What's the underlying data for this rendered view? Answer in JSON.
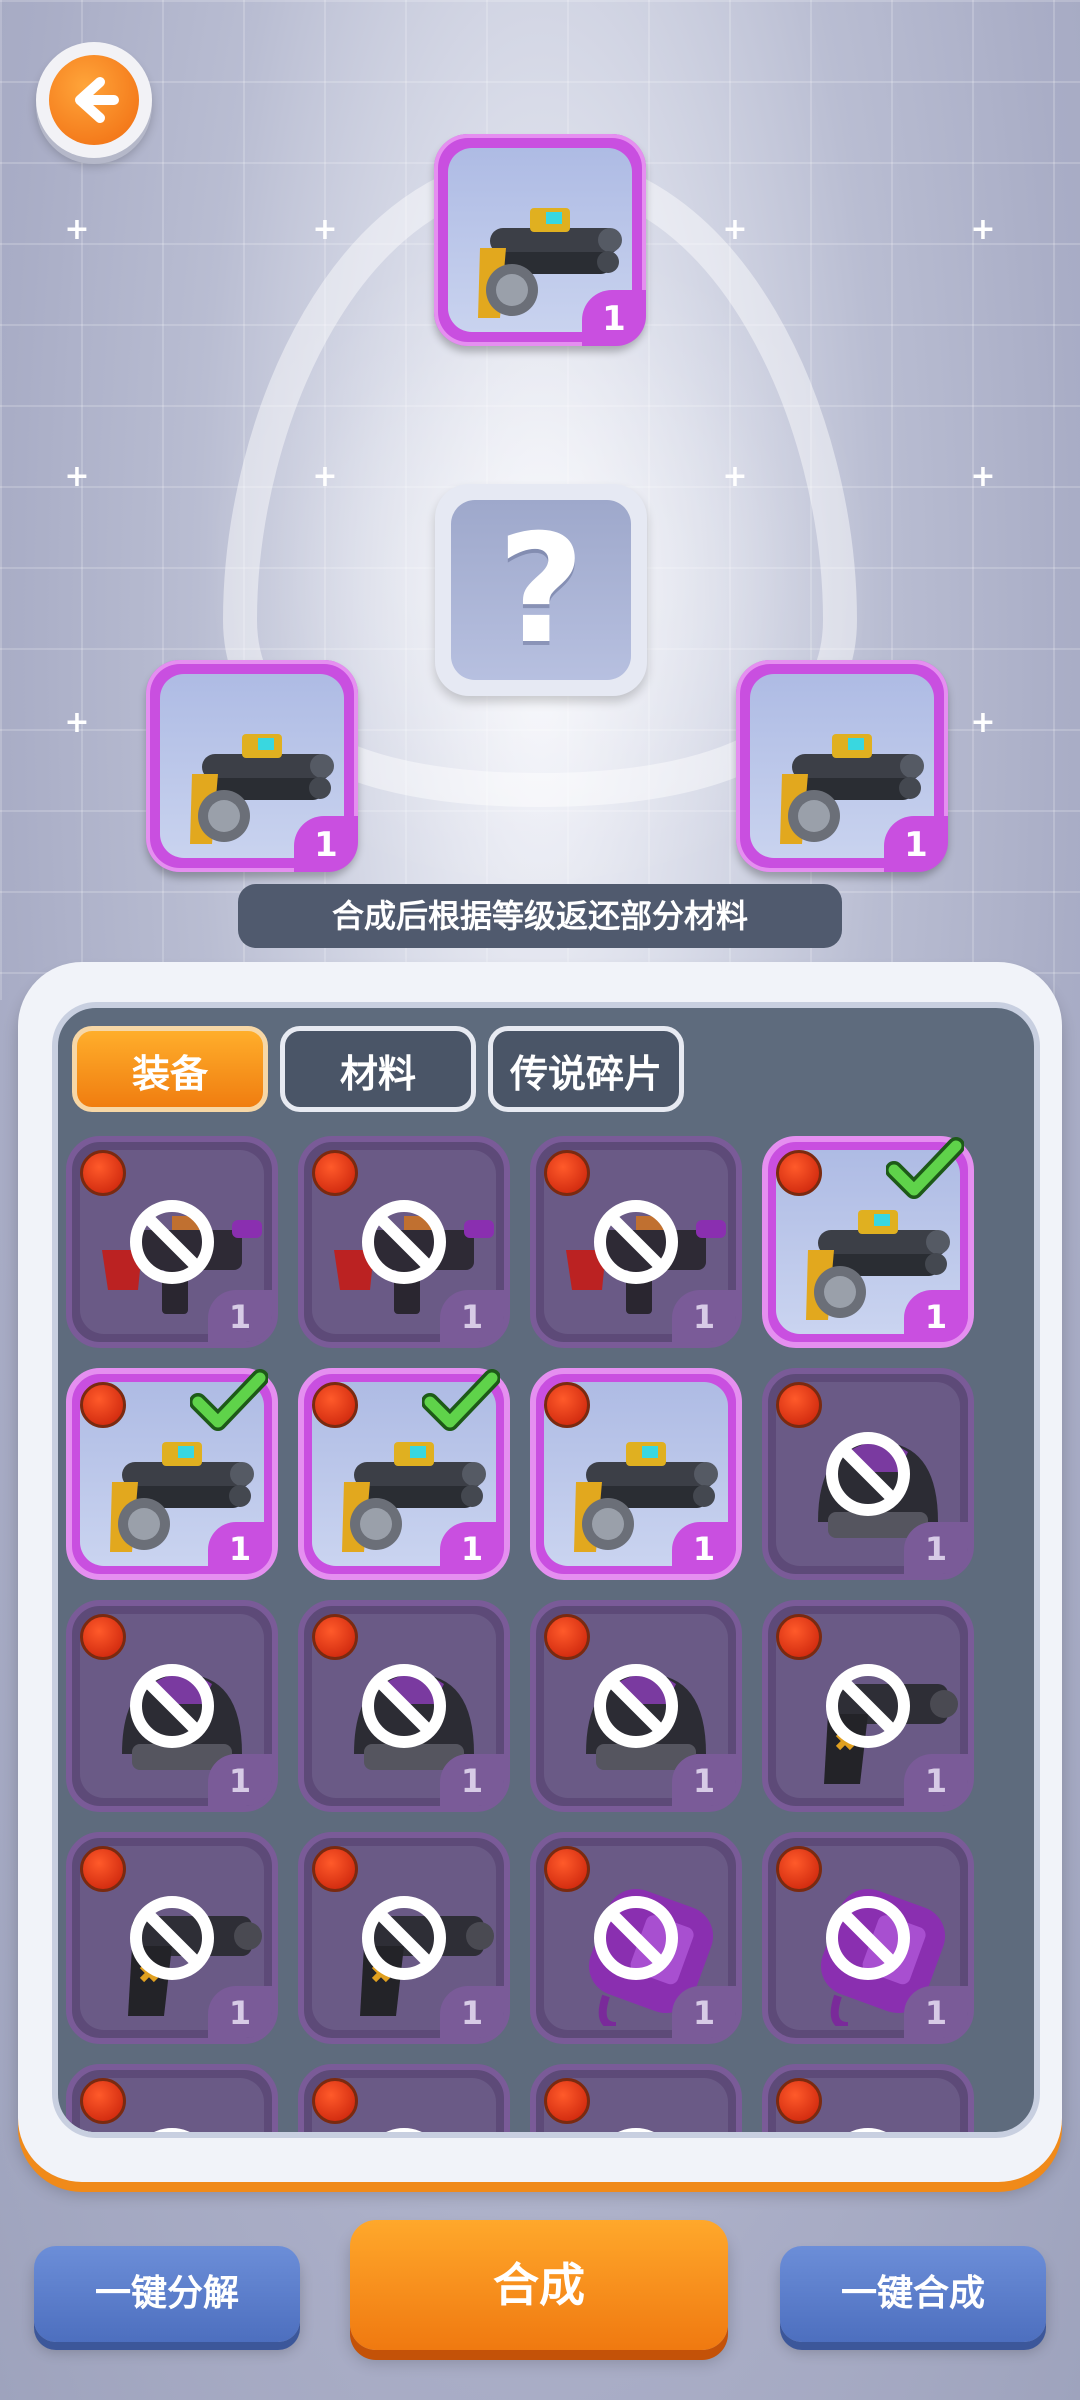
{
  "header": {
    "back_icon": "arrow-left-icon"
  },
  "fusion": {
    "top_slot_count": "1",
    "left_slot_count": "1",
    "right_slot_count": "1",
    "result_symbol": "?",
    "hint": "合成后根据等级返还部分材料"
  },
  "tabs": [
    {
      "label": "装备",
      "active": true
    },
    {
      "label": "材料",
      "active": false
    },
    {
      "label": "传说碎片",
      "active": false
    }
  ],
  "inventory": [
    {
      "item": "smg",
      "count": "1",
      "locked": true,
      "selected": false
    },
    {
      "item": "smg",
      "count": "1",
      "locked": true,
      "selected": false
    },
    {
      "item": "smg",
      "count": "1",
      "locked": true,
      "selected": false
    },
    {
      "item": "shotgun",
      "count": "1",
      "locked": false,
      "selected": true
    },
    {
      "item": "shotgun",
      "count": "1",
      "locked": false,
      "selected": true
    },
    {
      "item": "shotgun",
      "count": "1",
      "locked": false,
      "selected": true
    },
    {
      "item": "shotgun",
      "count": "1",
      "locked": false,
      "selected": false
    },
    {
      "item": "helmet",
      "count": "1",
      "locked": true,
      "selected": false
    },
    {
      "item": "helmet",
      "count": "1",
      "locked": true,
      "selected": false
    },
    {
      "item": "helmet",
      "count": "1",
      "locked": true,
      "selected": false
    },
    {
      "item": "helmet",
      "count": "1",
      "locked": true,
      "selected": false
    },
    {
      "item": "pistol",
      "count": "1",
      "locked": true,
      "selected": false
    },
    {
      "item": "pistol",
      "count": "1",
      "locked": true,
      "selected": false
    },
    {
      "item": "pistol",
      "count": "1",
      "locked": true,
      "selected": false
    },
    {
      "item": "umbrella-shield",
      "count": "1",
      "locked": true,
      "selected": false
    },
    {
      "item": "umbrella-shield",
      "count": "1",
      "locked": true,
      "selected": false
    }
  ],
  "buttons": {
    "disassemble": "一键分解",
    "combine": "合成",
    "auto_combine": "一键合成"
  },
  "colors": {
    "accent_orange": "#f07d10",
    "rarity_purple": "#c94fe0",
    "button_blue": "#5a7bcc",
    "panel_slate": "#5e6b7d"
  }
}
